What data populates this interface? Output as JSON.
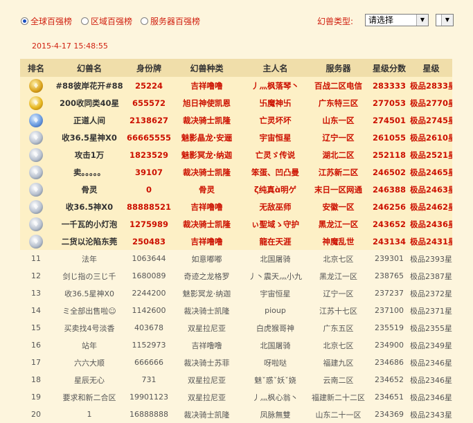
{
  "filters": {
    "radios": [
      {
        "label": "全球百强榜",
        "checked": true
      },
      {
        "label": "区域百强榜",
        "checked": false
      },
      {
        "label": "服务器百强榜",
        "checked": false
      }
    ],
    "beast_type_label": "幻兽类型:",
    "beast_type_value": "请选择",
    "secondary_select_value": ""
  },
  "timestamp": "2015-4-17 15:48:55",
  "table": {
    "headers": [
      "排名",
      "幻兽名",
      "身份牌",
      "幻兽种类",
      "主人名",
      "服务器",
      "星级分数",
      "星级"
    ],
    "top_rows": [
      {
        "icon": "gold-crown-rank-icon",
        "name": "#88彼岸花开#88",
        "id": "25224",
        "species": "吉祥噜噜",
        "owner": "丿灬枫落琴丶",
        "server": "百战二区电信",
        "score": "283333",
        "star": "极品2833星"
      },
      {
        "icon": "gold-gem-rank-icon",
        "name": "200收同类40星",
        "id": "655572",
        "species": "旭日神使凯恩",
        "owner": "卐魔神卐",
        "server": "广东特三区",
        "score": "277053",
        "star": "极品2770星"
      },
      {
        "icon": "blue-gem-rank-icon",
        "name": "正道人间",
        "id": "2138627",
        "species": "裁决骑士凯隆",
        "owner": "亡灵坏坏",
        "server": "山东一区",
        "score": "274501",
        "star": "极品2745星"
      },
      {
        "icon": "silver-rank-icon",
        "name": "收36.5星神X0",
        "id": "66665555",
        "species": "魅影晶龙·安逦",
        "owner": "宇宙恒星",
        "server": "辽宁一区",
        "score": "261055",
        "star": "极品2610星"
      },
      {
        "icon": "silver-rank-icon",
        "name": "攻击1万",
        "id": "1823529",
        "species": "魅影冥龙·纳迦",
        "owner": "亡灵ゞ传说",
        "server": "湖北二区",
        "score": "252118",
        "star": "极品2521星"
      },
      {
        "icon": "silver-rank-icon",
        "name": "卖。。。。。",
        "id": "39107",
        "species": "裁决骑士凯隆",
        "owner": "笨蛋、凹凸曼",
        "server": "江苏新二区",
        "score": "246502",
        "star": "极品2465星"
      },
      {
        "icon": "silver-rank-icon",
        "name": "骨灵",
        "id": "0",
        "species": "骨灵",
        "owner": "ζ纯真ɑ̀明ゲ",
        "server": "末日一区网通",
        "score": "246388",
        "star": "极品2463星"
      },
      {
        "icon": "silver-rank-icon",
        "name": "收36.5神X0",
        "id": "88888521",
        "species": "吉祥噜噜",
        "owner": "无敌巫师",
        "server": "安徽一区",
        "score": "246256",
        "star": "极品2462星"
      },
      {
        "icon": "silver-rank-icon",
        "name": "一千瓦的小灯泡",
        "id": "1275989",
        "species": "裁决骑士凯隆",
        "owner": "ぃ聖域ゝ守护",
        "server": "黑龙江一区",
        "score": "243652",
        "star": "极品2436星"
      },
      {
        "icon": "silver-rank-icon",
        "name": "二货以沦陷东莞",
        "id": "250483",
        "species": "吉祥噜噜",
        "owner": "龍在天涯",
        "server": "神魔乱世",
        "score": "243134",
        "star": "极品2431星"
      }
    ],
    "rows": [
      {
        "rank": "11",
        "name": "法年",
        "id": "1063644",
        "species": "如意嘟嘟",
        "owner": "北国屠骑",
        "server": "北京七区",
        "score": "239301",
        "star": "极品2393星"
      },
      {
        "rank": "12",
        "name": "剑じ指の三じ千",
        "id": "1680089",
        "species": "奇迹之龙格罗",
        "owner": "丿丶震天灬小九",
        "server": "黑龙江一区",
        "score": "238765",
        "star": "极品2387星"
      },
      {
        "rank": "13",
        "name": "收36.5星神X0",
        "id": "2244200",
        "species": "魅影冥龙·纳迦",
        "owner": "宇宙恒星",
        "server": "辽宁一区",
        "score": "237237",
        "star": "极品2372星"
      },
      {
        "rank": "14",
        "name": "ミ全部出售啦☺",
        "id": "1142600",
        "species": "裁决骑士凯隆",
        "owner": "pioup",
        "server": "江苏十七区",
        "score": "237100",
        "star": "极品2371星"
      },
      {
        "rank": "15",
        "name": "买卖找4号淡香",
        "id": "403678",
        "species": "双星拉尼亚",
        "owner": "白虎猴哥神",
        "server": "广东五区",
        "score": "235519",
        "star": "极品2355星"
      },
      {
        "rank": "16",
        "name": "站年",
        "id": "1152973",
        "species": "吉祥噜噜",
        "owner": "北国屠骑",
        "server": "北京七区",
        "score": "234900",
        "star": "极品2349星"
      },
      {
        "rank": "17",
        "name": "六六大顺",
        "id": "666666",
        "species": "裁决骑士苏菲",
        "owner": "呀啦哒",
        "server": "福建九区",
        "score": "234686",
        "star": "极品2346星"
      },
      {
        "rank": "18",
        "name": "星辰无心",
        "id": "731",
        "species": "双星拉尼亚",
        "owner": "魅ˇ惑ˇ妖ˇ娆",
        "server": "云南二区",
        "score": "234652",
        "star": "极品2346星"
      },
      {
        "rank": "19",
        "name": "要求和新二合区",
        "id": "19901123",
        "species": "双星拉尼亚",
        "owner": "丿灬枫心翁丶",
        "server": "福建新二十二区",
        "score": "234651",
        "star": "极品2346星"
      },
      {
        "rank": "20",
        "name": "1",
        "id": "16888888",
        "species": "裁决骑士凯隆",
        "owner": "凤脉無雙",
        "server": "山东二十一区",
        "score": "234369",
        "star": "极品2343星"
      }
    ]
  }
}
